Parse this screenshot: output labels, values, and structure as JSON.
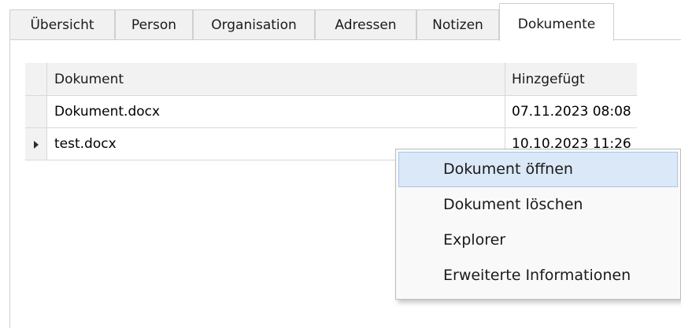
{
  "tabs": [
    {
      "label": "Übersicht"
    },
    {
      "label": "Person"
    },
    {
      "label": "Organisation"
    },
    {
      "label": "Adressen"
    },
    {
      "label": "Notizen"
    },
    {
      "label": "Dokumente",
      "active": true
    }
  ],
  "grid": {
    "columns": {
      "document": "Dokument",
      "added": "Hinzgefügt"
    },
    "rows": [
      {
        "document": "Dokument.docx",
        "added": "07.11.2023 08:08",
        "current": false
      },
      {
        "document": "test.docx",
        "added": "10.10.2023 11:26",
        "current": true
      }
    ]
  },
  "context_menu": {
    "items": [
      {
        "label": "Dokument öffnen",
        "highlighted": true
      },
      {
        "label": "Dokument löschen"
      },
      {
        "label": "Explorer"
      },
      {
        "label": "Erweiterte Informationen"
      }
    ]
  },
  "colors": {
    "menu_highlight": "#dbe8f7",
    "menu_highlight_border": "#a9c6e8",
    "header_background": "#f2f2f2"
  }
}
